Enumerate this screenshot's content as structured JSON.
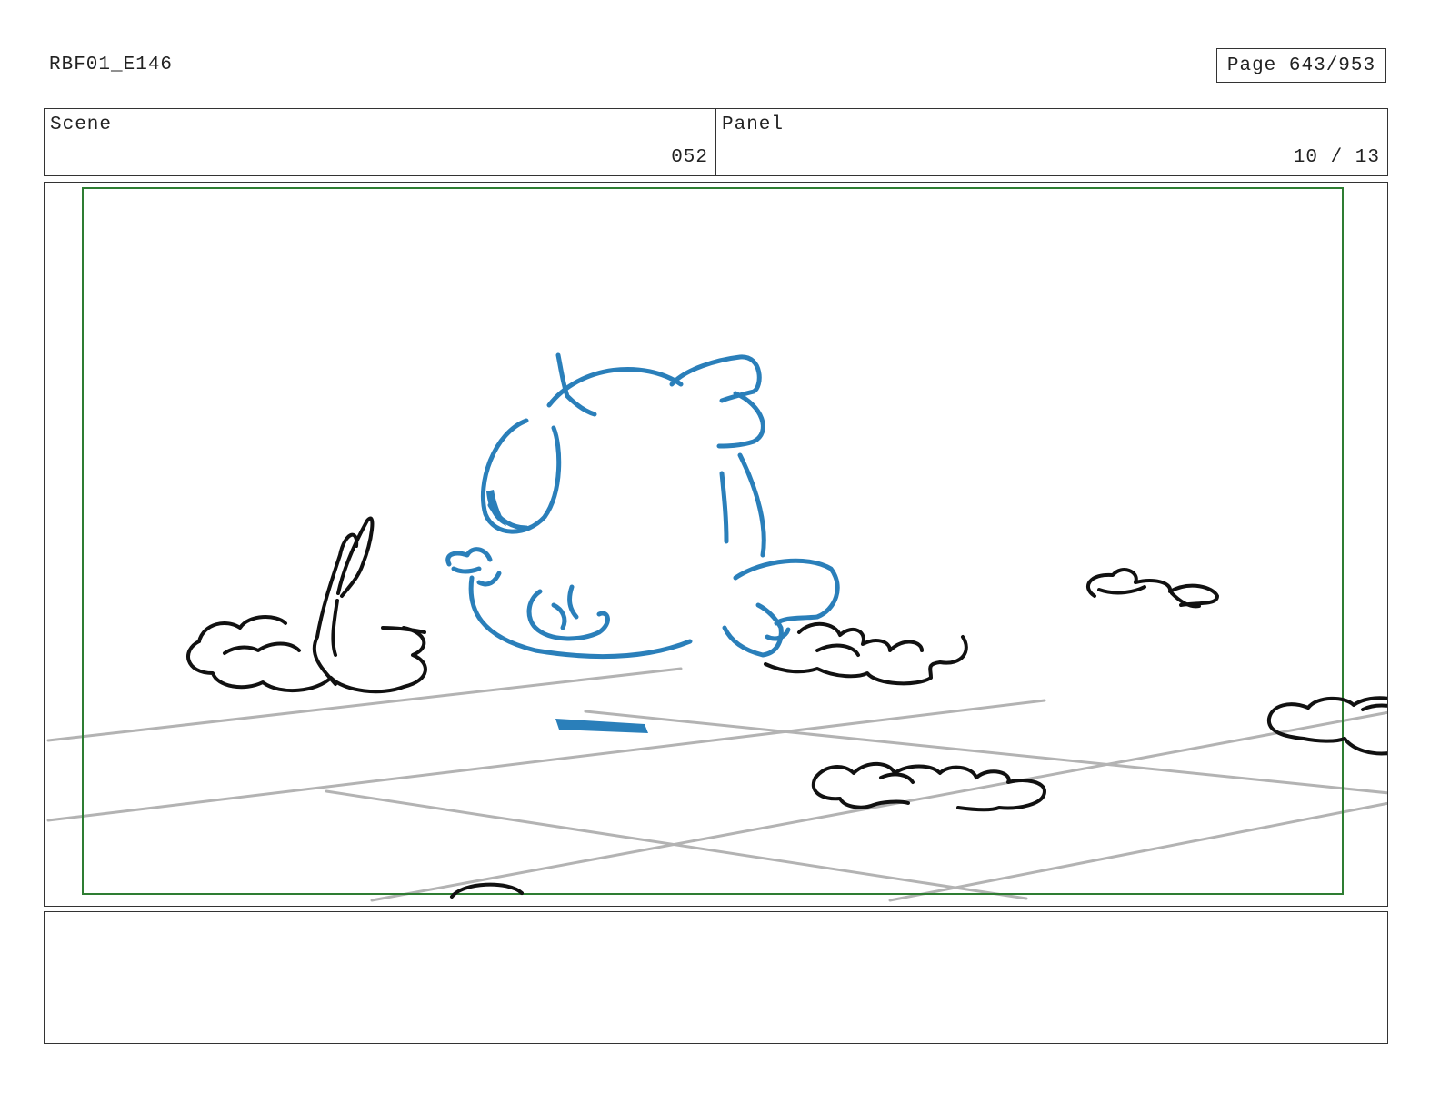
{
  "header": {
    "document_id": "RBF01_E146",
    "page_label": "Page 643/953"
  },
  "info": {
    "scene_label": "Scene",
    "scene_value": "052",
    "panel_label": "Panel",
    "panel_value": "10 / 13"
  },
  "colors": {
    "safe_area": "#2e7d32",
    "character_sketch": "#2a7fba",
    "ink": "#111111",
    "floor_lines": "#b3b3b3"
  },
  "notes": {
    "text": ""
  }
}
